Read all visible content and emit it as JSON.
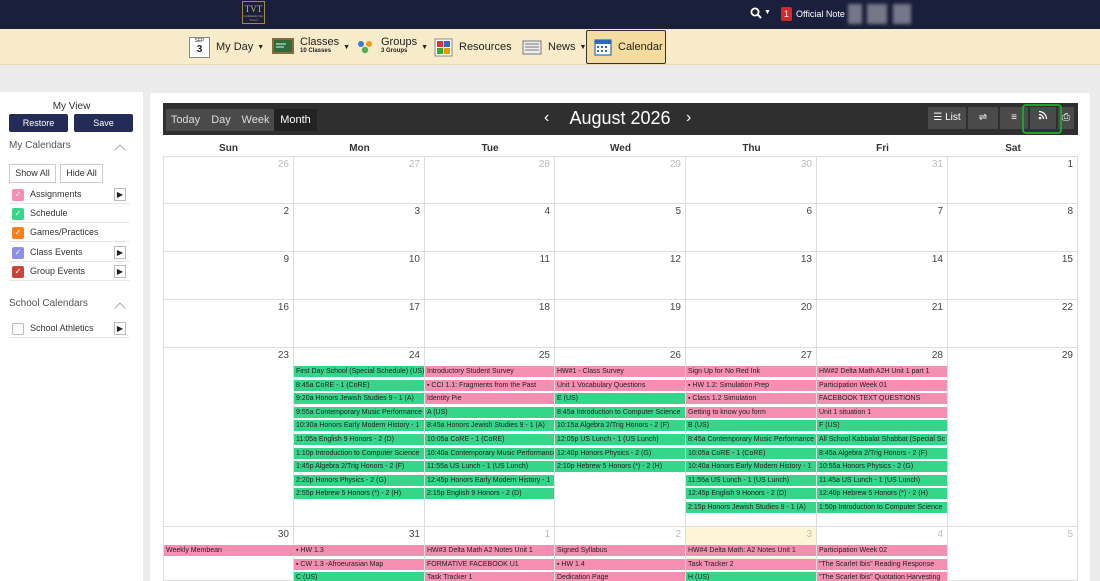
{
  "topbar": {
    "logo_text": "TVT",
    "logo_sub": "Community Day School",
    "notification_count": "1",
    "note_label": "Official Note"
  },
  "nav": {
    "date_month": "SEP",
    "date_day": "3",
    "myday": "My Day",
    "classes": "Classes",
    "classes_count": "10 Classes",
    "groups": "Groups",
    "groups_count": "3 Groups",
    "resources": "Resources",
    "news": "News",
    "calendar": "Calendar"
  },
  "sidebar": {
    "title": "My View",
    "restore": "Restore",
    "save": "Save",
    "my_calendars": "My Calendars",
    "show_all": "Show All",
    "hide_all": "Hide All",
    "items": [
      {
        "label": "Assignments",
        "color": "#f48fb1",
        "arrow": true
      },
      {
        "label": "Schedule",
        "color": "#35d68a",
        "arrow": false
      },
      {
        "label": "Games/Practices",
        "color": "#f97f1e",
        "arrow": false
      },
      {
        "label": "Class Events",
        "color": "#8f8fe6",
        "arrow": true
      },
      {
        "label": "Group Events",
        "color": "#c9453b",
        "arrow": true
      }
    ],
    "school_calendars": "School Calendars",
    "school_items": [
      {
        "label": "School Athletics",
        "arrow": true
      }
    ]
  },
  "toolbar": {
    "views": [
      "Today",
      "Day",
      "Week",
      "Month"
    ],
    "active_view": "Month",
    "month_title": "August 2026",
    "list_label": "List"
  },
  "calendar": {
    "days": [
      "Sun",
      "Mon",
      "Tue",
      "Wed",
      "Thu",
      "Fri",
      "Sat"
    ],
    "weeks": [
      [
        {
          "n": "26",
          "o": true
        },
        {
          "n": "27",
          "o": true
        },
        {
          "n": "28",
          "o": true
        },
        {
          "n": "29",
          "o": true
        },
        {
          "n": "30",
          "o": true
        },
        {
          "n": "31",
          "o": true
        },
        {
          "n": "1"
        }
      ],
      [
        {
          "n": "2"
        },
        {
          "n": "3"
        },
        {
          "n": "4"
        },
        {
          "n": "5"
        },
        {
          "n": "6"
        },
        {
          "n": "7"
        },
        {
          "n": "8"
        }
      ],
      [
        {
          "n": "9"
        },
        {
          "n": "10"
        },
        {
          "n": "11"
        },
        {
          "n": "12"
        },
        {
          "n": "13"
        },
        {
          "n": "14"
        },
        {
          "n": "15"
        }
      ],
      [
        {
          "n": "16"
        },
        {
          "n": "17"
        },
        {
          "n": "18"
        },
        {
          "n": "19"
        },
        {
          "n": "20"
        },
        {
          "n": "21"
        },
        {
          "n": "22"
        }
      ],
      [
        {
          "n": "23",
          "events": []
        },
        {
          "n": "24",
          "events": [
            {
              "t": "First Day School (Special Schedule) (US)",
              "c": "green"
            },
            {
              "t": "8:45a CoRE - 1 (CoRE)",
              "c": "green"
            },
            {
              "t": "9:20a Honors Jewish Studies 9 - 1 (A)",
              "c": "green"
            },
            {
              "t": "9:55a Contemporary Music Performance",
              "c": "green"
            },
            {
              "t": "10:30a Honors Early Modern History - 1",
              "c": "green"
            },
            {
              "t": "11:05a English 9 Honors - 2 (D)",
              "c": "green"
            },
            {
              "t": "1:10p Introduction to Computer Science",
              "c": "green"
            },
            {
              "t": "1:45p Algebra 2/Trig Honors - 2 (F)",
              "c": "green"
            },
            {
              "t": "2:20p Honors Physics - 2 (G)",
              "c": "green"
            },
            {
              "t": "2:55p Hebrew 5 Honors (*) - 2 (H)",
              "c": "green"
            }
          ]
        },
        {
          "n": "25",
          "events": [
            {
              "t": "Introductory Student Survey",
              "c": "pink"
            },
            {
              "t": "▪ CCI 1.1: Fragments from the Past",
              "c": "pink"
            },
            {
              "t": "Identity Pie",
              "c": "pink"
            },
            {
              "t": "A (US)",
              "c": "green"
            },
            {
              "t": "8:45a Honors Jewish Studies 9 - 1 (A)",
              "c": "green"
            },
            {
              "t": "10:05a CoRE - 1 (CoRE)",
              "c": "green"
            },
            {
              "t": "10:40a Contemporary Music Performance",
              "c": "green"
            },
            {
              "t": "11:55a US Lunch - 1 (US Lunch)",
              "c": "green"
            },
            {
              "t": "12:45p Honors Early Modern History - 1",
              "c": "green"
            },
            {
              "t": "2:15p English 9 Honors - 2 (D)",
              "c": "green"
            }
          ]
        },
        {
          "n": "26",
          "events": [
            {
              "t": "HW#1 - Class Survey",
              "c": "pink"
            },
            {
              "t": "Unit 1 Vocabulary Questions",
              "c": "pink"
            },
            {
              "t": "E (US)",
              "c": "green"
            },
            {
              "t": "8:45a Introduction to Computer Science",
              "c": "green"
            },
            {
              "t": "10:15a Algebra 2/Trig Honors - 2 (F)",
              "c": "green"
            },
            {
              "t": "12:05p US Lunch - 1 (US Lunch)",
              "c": "green"
            },
            {
              "t": "12:40p Honors Physics - 2 (G)",
              "c": "green"
            },
            {
              "t": "2:10p Hebrew 5 Honors (*) - 2 (H)",
              "c": "green"
            }
          ]
        },
        {
          "n": "27",
          "events": [
            {
              "t": "Sign Up for No Red Ink",
              "c": "pink"
            },
            {
              "t": "▪ HW 1.2: Simulation Prep",
              "c": "pink"
            },
            {
              "t": "▪ Class 1.2 Simulation",
              "c": "pink"
            },
            {
              "t": "Getting to know you form",
              "c": "pink"
            },
            {
              "t": "B (US)",
              "c": "green"
            },
            {
              "t": "8:45a Contemporary Music Performance",
              "c": "green"
            },
            {
              "t": "10:05a CoRE - 1 (CoRE)",
              "c": "green"
            },
            {
              "t": "10:40a Honors Early Modern History - 1",
              "c": "green"
            },
            {
              "t": "11:55a US Lunch - 1 (US Lunch)",
              "c": "green"
            },
            {
              "t": "12:45p English 9 Honors - 2 (D)",
              "c": "green"
            },
            {
              "t": "2:15p Honors Jewish Studies 9 - 1 (A)",
              "c": "green"
            }
          ]
        },
        {
          "n": "28",
          "events": [
            {
              "t": "HW#2 Delta Math A2H  Unit 1 part 1",
              "c": "pink"
            },
            {
              "t": "Participation Week 01",
              "c": "pink"
            },
            {
              "t": "FACEBOOK TEXT QUESTIONS",
              "c": "pink"
            },
            {
              "t": "Unit 1 situation 1",
              "c": "pink"
            },
            {
              "t": "F (US)",
              "c": "green"
            },
            {
              "t": "All School Kabbalat Shabbat (Special Sc",
              "c": "green"
            },
            {
              "t": "8:45a Algebra 2/Trig Honors - 2 (F)",
              "c": "green"
            },
            {
              "t": "10:55a Honors Physics - 2 (G)",
              "c": "green"
            },
            {
              "t": "11:45a US Lunch - 1 (US Lunch)",
              "c": "green"
            },
            {
              "t": "12:40p Hebrew 5 Honors (*) - 2 (H)",
              "c": "green"
            },
            {
              "t": "1:50p Introduction to Computer Science",
              "c": "green"
            }
          ]
        },
        {
          "n": "29",
          "events": []
        }
      ],
      [
        {
          "n": "30",
          "events": [
            {
              "t": "Weekly Membean",
              "c": "pink"
            }
          ]
        },
        {
          "n": "31",
          "events": [
            {
              "t": "▪ HW 1.3",
              "c": "pink"
            },
            {
              "t": "▪ CW 1.3 -Afroeurasian Map",
              "c": "pink"
            },
            {
              "t": "C (US)",
              "c": "green"
            }
          ]
        },
        {
          "n": "1",
          "o": true,
          "events": [
            {
              "t": "HW#3 Delta Math A2 Notes Unit 1",
              "c": "pink"
            },
            {
              "t": "FORMATIVE FACEBOOK U1",
              "c": "pink"
            },
            {
              "t": "Task Tracker 1",
              "c": "pink"
            }
          ]
        },
        {
          "n": "2",
          "o": true,
          "events": [
            {
              "t": "Signed Syllabus",
              "c": "pink"
            },
            {
              "t": "▪ HW 1.4",
              "c": "pink"
            },
            {
              "t": "Dedication Page",
              "c": "pink"
            }
          ]
        },
        {
          "n": "3",
          "o": true,
          "today": true,
          "events": [
            {
              "t": "HW#4 Delta Math: A2 Notes Unit 1",
              "c": "pink"
            },
            {
              "t": "Task Tracker 2",
              "c": "pink"
            },
            {
              "t": "H (US)",
              "c": "green"
            }
          ]
        },
        {
          "n": "4",
          "o": true,
          "events": [
            {
              "t": "Participation Week 02",
              "c": "pink"
            },
            {
              "t": "\"The Scarlet Ibis\"  Reading Response",
              "c": "pink"
            },
            {
              "t": "\"The Scarlet Ibis\" Quotation Harvesting",
              "c": "pink"
            }
          ]
        },
        {
          "n": "5",
          "o": true,
          "events": []
        }
      ]
    ]
  }
}
